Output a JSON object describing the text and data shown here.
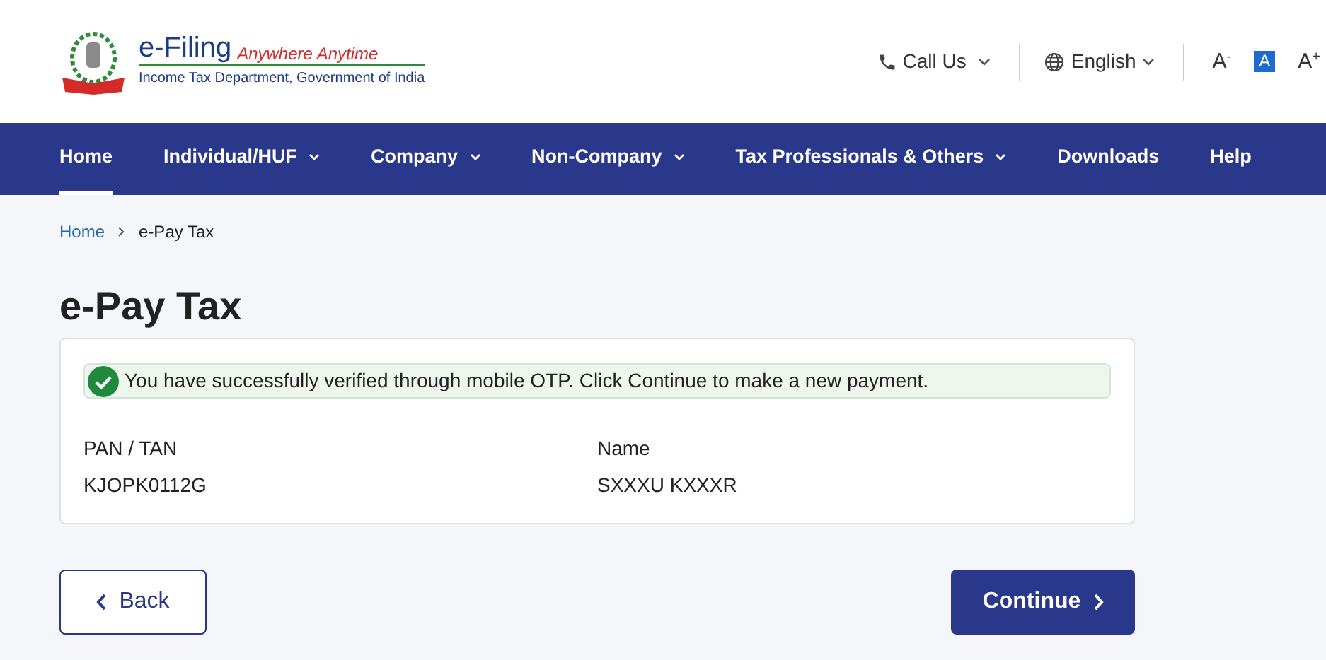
{
  "logo": {
    "title": "e-Filing",
    "tagline": "Anywhere Anytime",
    "subtitle": "Income Tax Department, Government of India"
  },
  "header": {
    "call_us": "Call Us",
    "language": "English",
    "font_sizes": [
      {
        "label": "A",
        "sup": "-",
        "selected": false
      },
      {
        "label": "A",
        "selected": true
      },
      {
        "label": "A",
        "sup": "+",
        "selected": false
      }
    ]
  },
  "nav": [
    {
      "label": "Home",
      "selected": true,
      "dropdown": false
    },
    {
      "label": "Individual/HUF",
      "selected": false,
      "dropdown": true
    },
    {
      "label": "Company",
      "selected": false,
      "dropdown": true
    },
    {
      "label": "Non-Company",
      "selected": false,
      "dropdown": true
    },
    {
      "label": "Tax Professionals & Others",
      "selected": false,
      "dropdown": true
    },
    {
      "label": "Downloads",
      "selected": false,
      "dropdown": false
    },
    {
      "label": "Help",
      "selected": false,
      "dropdown": false
    }
  ],
  "breadcrumb": [
    "Home",
    "e-Pay Tax"
  ],
  "page_title": "e-Pay Tax",
  "alert": "You have successfully verified through mobile OTP. Click Continue to make a new payment.",
  "fields": [
    {
      "label": "PAN / TAN",
      "value": "KJOPK0112G"
    },
    {
      "label": "Name",
      "value": "SXXXU KXXXR"
    }
  ],
  "buttons": {
    "back": "Back",
    "continue": "Continue"
  }
}
